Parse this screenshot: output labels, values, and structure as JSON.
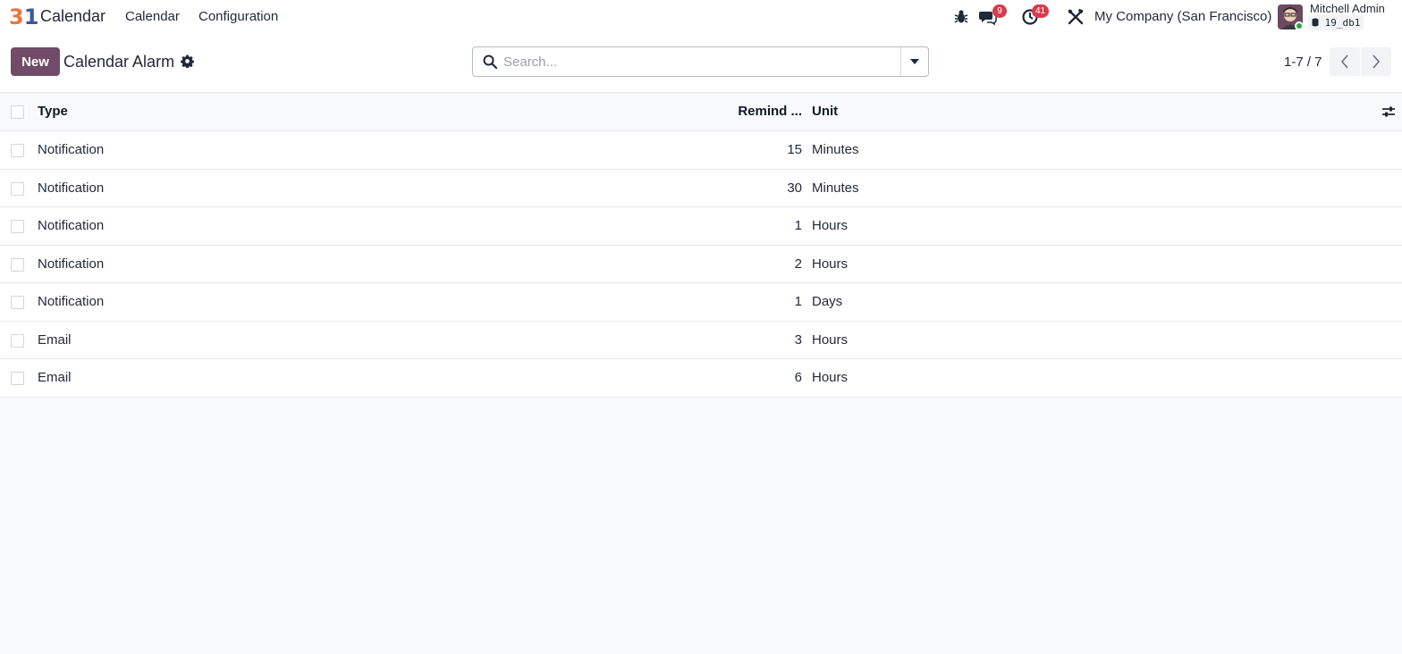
{
  "navbar": {
    "app_logo_part1": "3",
    "app_logo_part2": "1",
    "app_name": "Calendar",
    "menu": [
      "Calendar",
      "Configuration"
    ],
    "messages_count": "9",
    "activities_count": "41",
    "company": "My Company (San Francisco)",
    "user_name": "Mitchell Admin",
    "database": "19_db1"
  },
  "control_panel": {
    "new_label": "New",
    "title": "Calendar Alarm",
    "search_placeholder": "Search...",
    "pager_value": "1-7 / 7"
  },
  "table": {
    "columns": {
      "type": "Type",
      "remind": "Remind ...",
      "unit": "Unit"
    },
    "rows": [
      {
        "type": "Notification",
        "remind": "15",
        "unit": "Minutes"
      },
      {
        "type": "Notification",
        "remind": "30",
        "unit": "Minutes"
      },
      {
        "type": "Notification",
        "remind": "1",
        "unit": "Hours"
      },
      {
        "type": "Notification",
        "remind": "2",
        "unit": "Hours"
      },
      {
        "type": "Notification",
        "remind": "1",
        "unit": "Days"
      },
      {
        "type": "Email",
        "remind": "3",
        "unit": "Hours"
      },
      {
        "type": "Email",
        "remind": "6",
        "unit": "Hours"
      }
    ]
  },
  "colors": {
    "primary": "#714b67",
    "badge": "#d63b4d",
    "online": "#28a745"
  }
}
